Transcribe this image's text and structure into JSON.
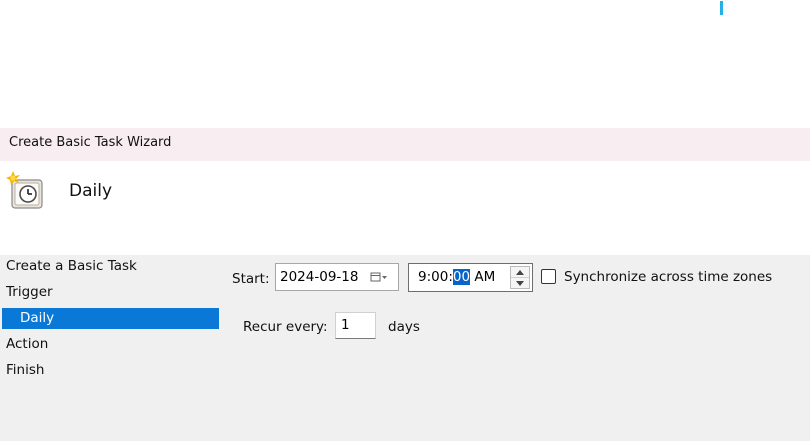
{
  "window": {
    "title": "Create Basic Task Wizard"
  },
  "header": {
    "title": "Daily",
    "icon": "scheduled-task-clock-icon"
  },
  "nav": {
    "items": [
      {
        "label": "Create a Basic Task",
        "selected": false
      },
      {
        "label": "Trigger",
        "selected": false
      },
      {
        "label": "Daily",
        "selected": true
      },
      {
        "label": "Action",
        "selected": false
      },
      {
        "label": "Finish",
        "selected": false
      }
    ]
  },
  "trigger": {
    "start_label": "Start:",
    "start_date": "2024-09-18",
    "time": {
      "hour_min": "9:00:",
      "seconds_selected": "00",
      "ampm": " AM"
    },
    "sync_label": "Synchronize across time zones",
    "sync_checked": false,
    "recur_label": "Recur every:",
    "recur_value": "1",
    "recur_unit": "days"
  },
  "colors": {
    "selection": "#0a78d7",
    "titlebar": "#f8eef1",
    "panel": "#f0f0f0"
  }
}
